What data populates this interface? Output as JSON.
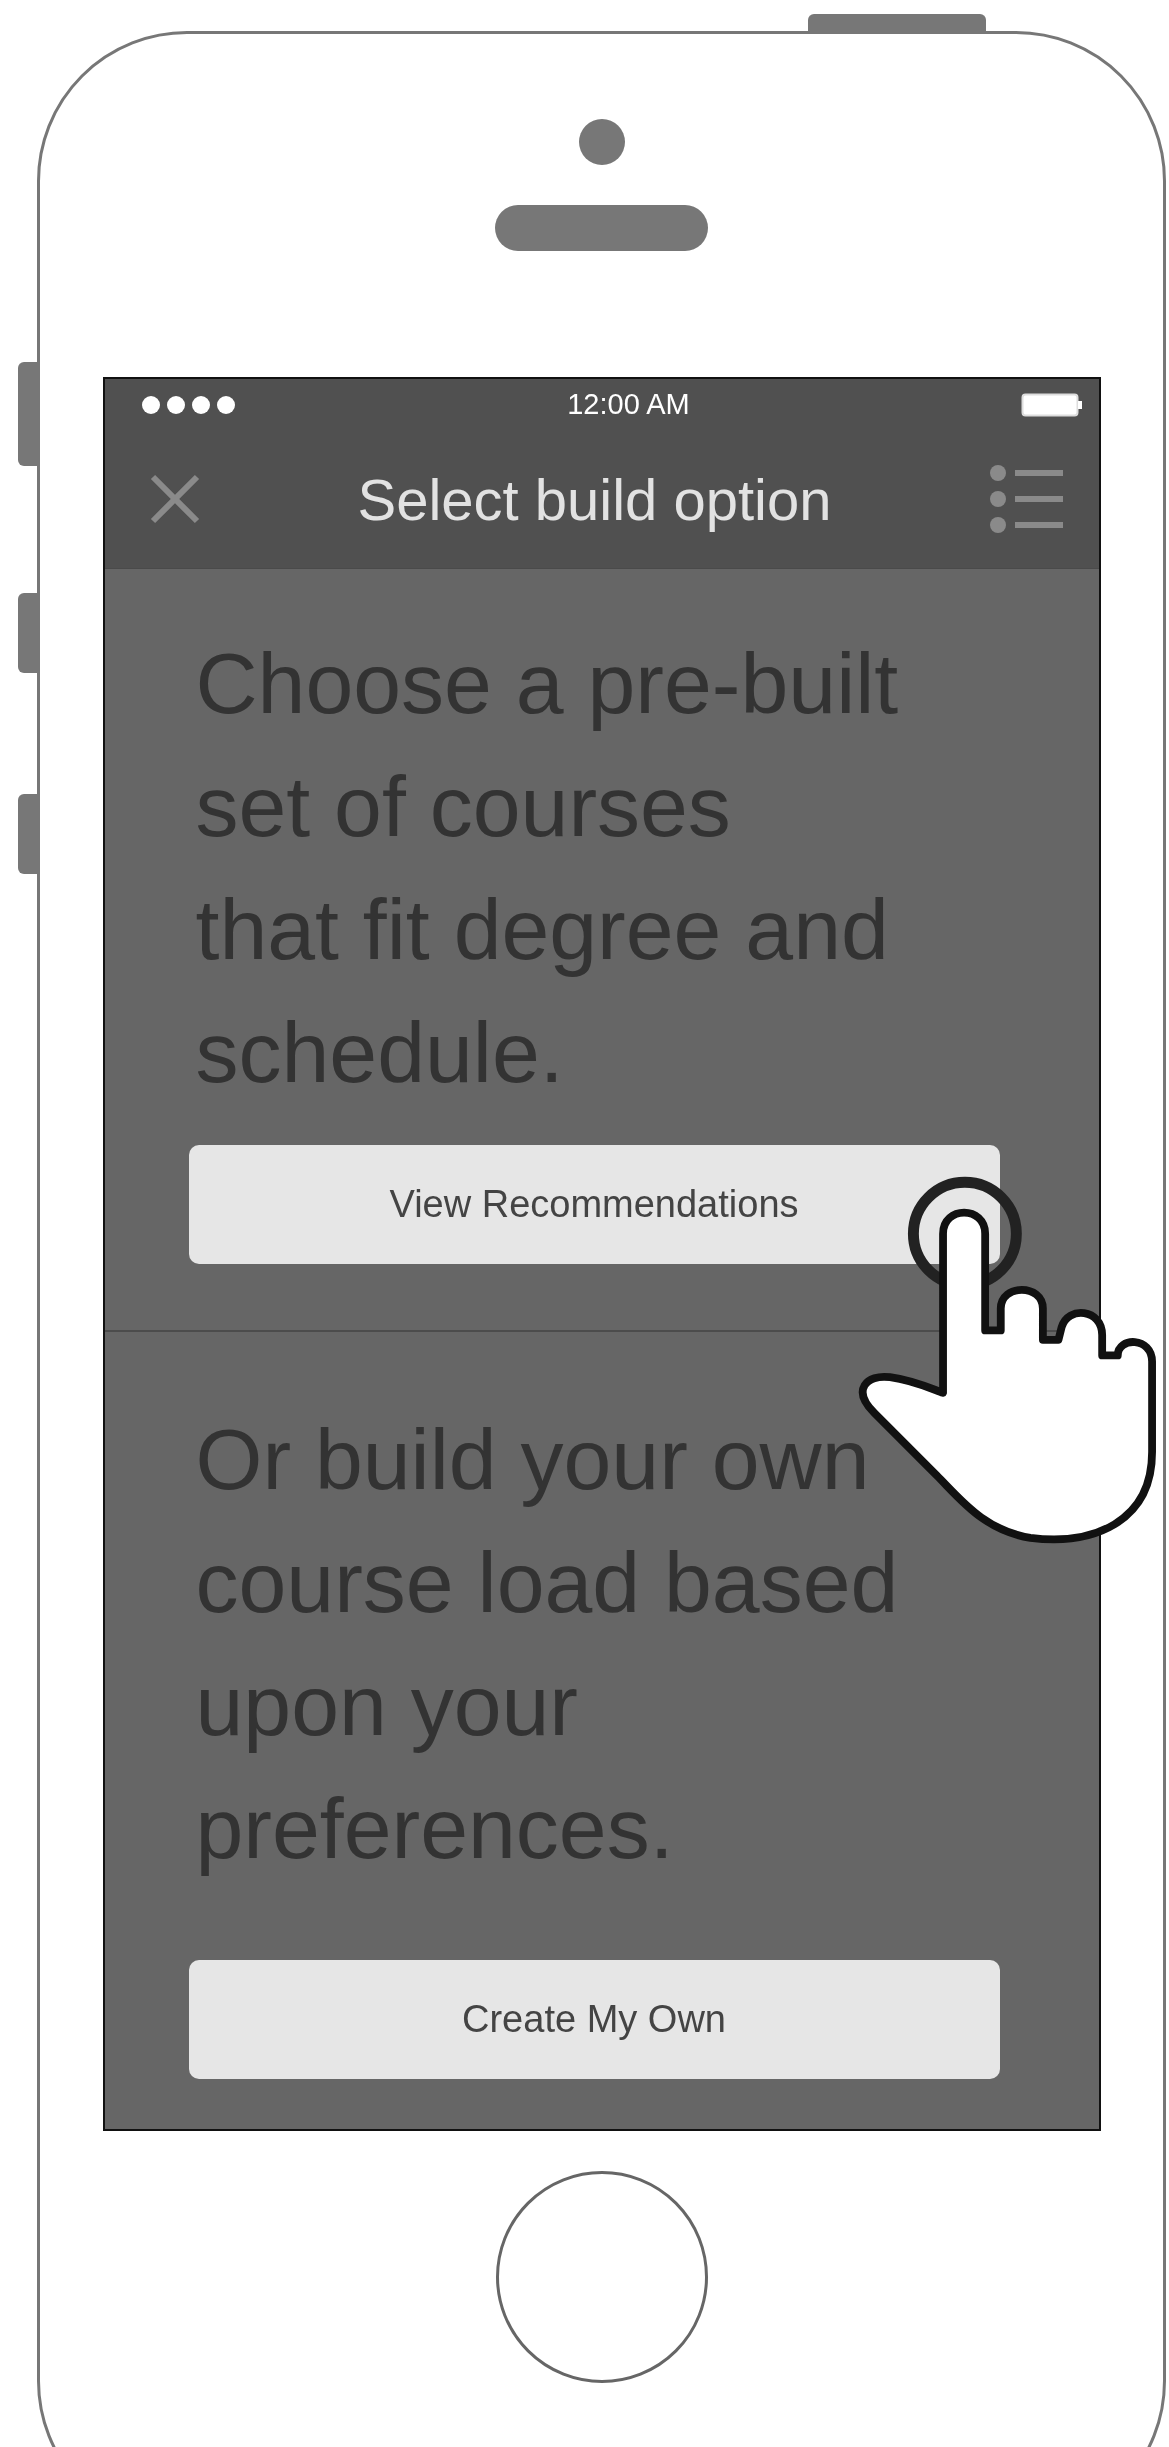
{
  "status_bar": {
    "time": "12:00 AM"
  },
  "nav_bar": {
    "title": "Select build option"
  },
  "sections": [
    {
      "lines": [
        "Choose a pre-built",
        "set of courses",
        "that fit degree and",
        "schedule."
      ],
      "button": "View Recommendations"
    },
    {
      "lines": [
        "Or build your own",
        "course load based",
        "upon your",
        "preferences."
      ],
      "button": "Create My Own"
    }
  ]
}
